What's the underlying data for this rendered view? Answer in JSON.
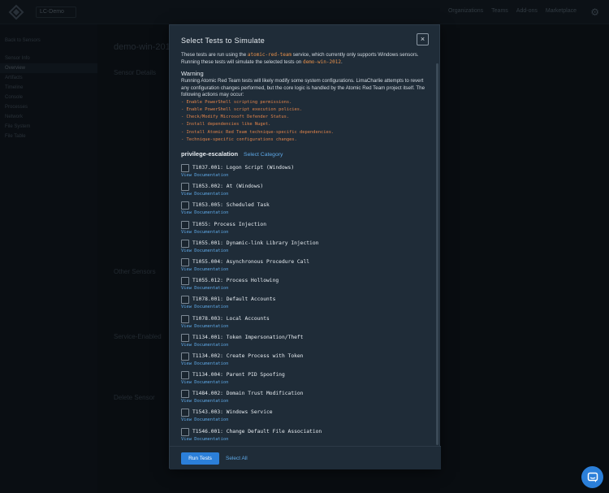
{
  "app": {
    "org_select": "LC-Demo",
    "nav": [
      "Organizations",
      "Teams",
      "Add-ons",
      "Marketplace"
    ],
    "sidebar": [
      "Back to Sensors",
      "Sensor Info",
      "Overview",
      "Artifacts",
      "Timeline",
      "Console",
      "Processes",
      "Network",
      "File System",
      "File Table"
    ],
    "page_title": "demo-win-2012",
    "panel_title": "Sensor Details",
    "other_sensors": "Other Sensors",
    "service_enabled": "Service-Enabled",
    "delete_sensor": "Delete Sensor"
  },
  "modal": {
    "title": "Select Tests to Simulate",
    "close": "×",
    "intro_1": "These tests are run using the ",
    "intro_service": "atomic-red-team",
    "intro_2": " service, which currently only supports Windows sensors. Running these tests will simulate the selected tests on ",
    "intro_sensor": "demo-win-2012",
    "intro_3": ".",
    "warning_title": "Warning",
    "warning_body": "Running Atomic Red Team tests will likely modify some system configurations. LimaCharlie attempts to revert any configuration changes performed, but the core logic is handled by the Atomic Red Team project itself. The following actions may occur:",
    "warning_items": [
      "- Enable PowerShell scripting permissions.",
      "- Enable PowerShell script execution policies.",
      "- Check/Modify Microsoft Defender Status.",
      "- Install dependencies like Nuget.",
      "- Install Atomic Red Team technique-specific dependencies.",
      "- Technique-specific configurations changes."
    ],
    "category": "privilege-escalation",
    "select_category": "Select Category",
    "view_doc": "View Documentation",
    "tests": [
      "T1037.001: Logon Script (Windows)",
      "T1053.002: At (Windows)",
      "T1053.005: Scheduled Task",
      "T1055: Process Injection",
      "T1055.001: Dynamic-link Library Injection",
      "T1055.004: Asynchronous Procedure Call",
      "T1055.012: Process Hollowing",
      "T1078.001: Default Accounts",
      "T1078.003: Local Accounts",
      "T1134.001: Token Impersonation/Theft",
      "T1134.002: Create Process with Token",
      "T1134.004: Parent PID Spoofing",
      "T1484.002: Domain Trust Modification",
      "T1543.003: Windows Service",
      "T1546.001: Change Default File Association"
    ],
    "run_tests": "Run Tests",
    "select_all": "Select All"
  }
}
